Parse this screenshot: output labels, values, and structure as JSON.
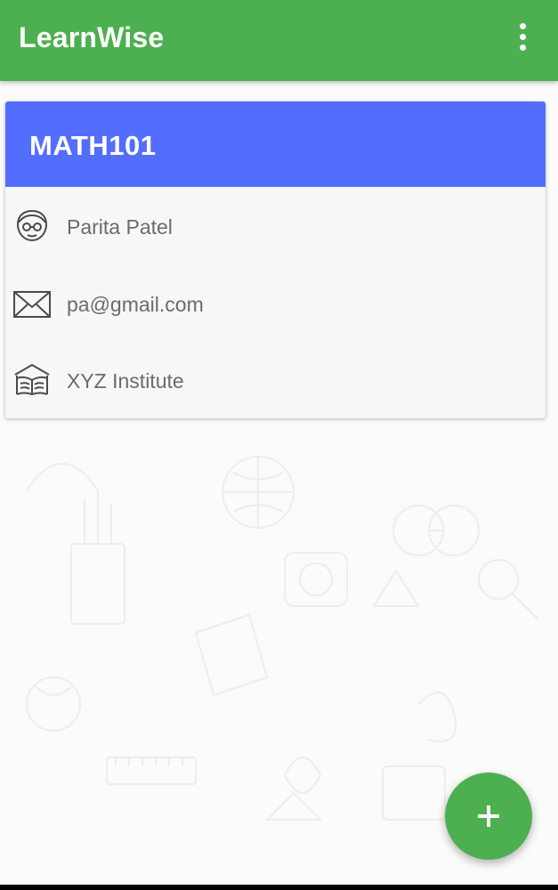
{
  "appbar": {
    "title": "LearnWise",
    "menu_icon": "more-vert-icon"
  },
  "course_card": {
    "code": "MATH101",
    "teacher": {
      "icon": "teacher-icon",
      "value": "Parita Patel"
    },
    "email": {
      "icon": "mail-icon",
      "value": "pa@gmail.com"
    },
    "institute": {
      "icon": "institute-icon",
      "value": "XYZ Institute"
    }
  },
  "fab": {
    "icon": "add-icon"
  },
  "colors": {
    "appbar": "#4caf50",
    "card_header": "#536dfe",
    "fab": "#4caf50",
    "card_body": "#f6f7f9",
    "row_text": "#6b6b6b"
  }
}
